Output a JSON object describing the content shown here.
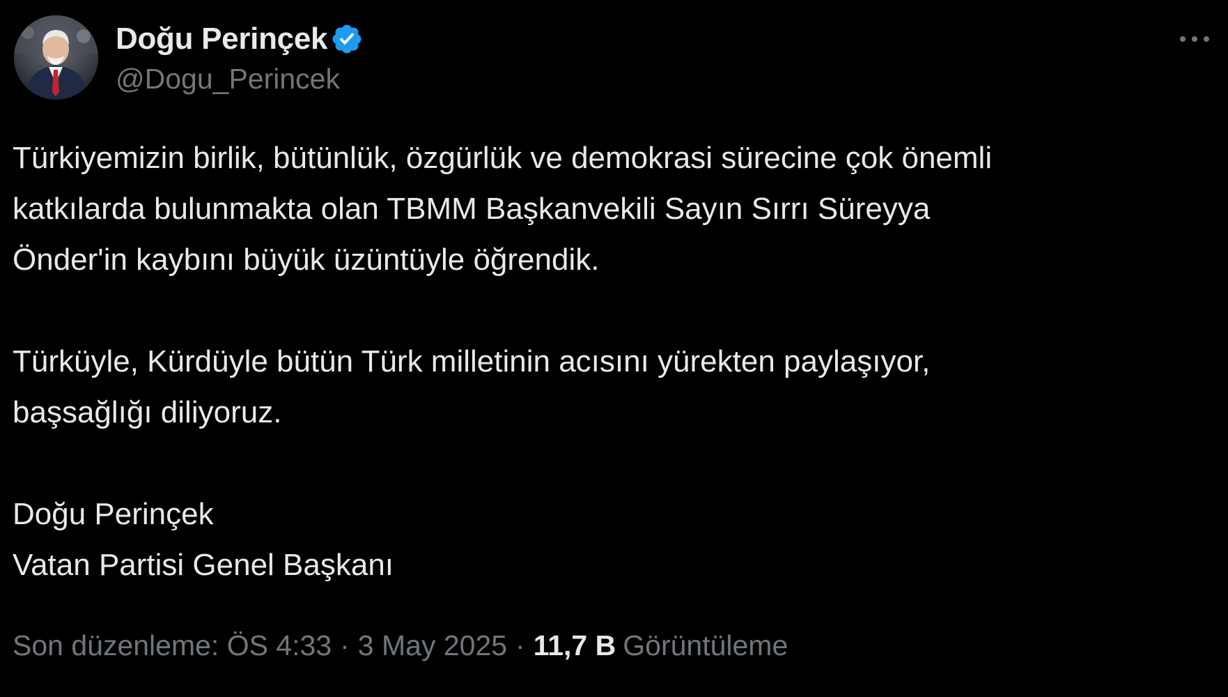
{
  "author": {
    "name": "Doğu Perinçek",
    "handle": "@Dogu_Perincek",
    "verified_icon": "verified-badge-icon",
    "verified_color": "#1d9bf0"
  },
  "menu": {
    "more_icon": "more-options-icon"
  },
  "tweet": {
    "lines": [
      "Türkiyemizin birlik, bütünlük, özgürlük ve demokrasi sürecine çok önemli",
      "katkılarda bulunmakta olan TBMM Başkanvekili Sayın Sırrı Süreyya",
      "Önder'in kaybını büyük üzüntüyle öğrendik.",
      "Türküyle, Kürdüyle bütün Türk milletinin acısını yürekten paylaşıyor,",
      "başsağlığı diliyoruz.",
      "Doğu Perinçek",
      "Vatan Partisi Genel Başkanı"
    ]
  },
  "meta": {
    "edited_label": "Son düzenleme: ÖS 4:33",
    "separator": "·",
    "date": "3 May 2025",
    "views_count": "11,7 B",
    "views_label": "Görüntüleme"
  },
  "colors": {
    "background": "#000000",
    "primary_text": "#e7e9ea",
    "secondary_text": "#71767b"
  }
}
